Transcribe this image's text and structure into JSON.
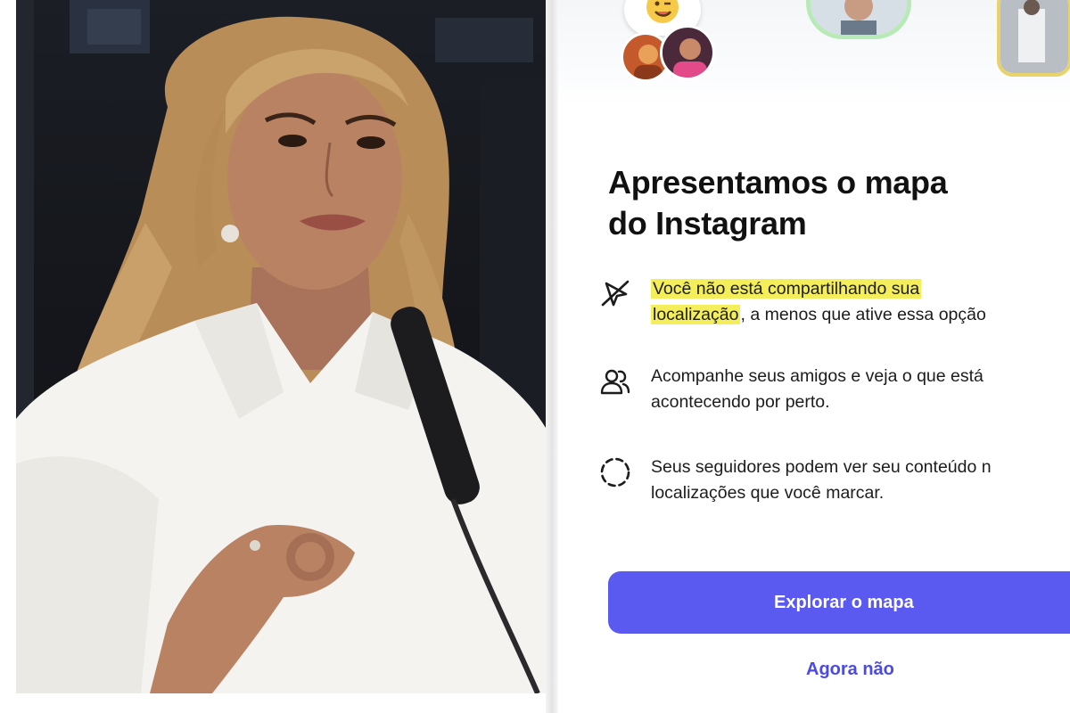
{
  "photo": {
    "subject": "Woman with blonde wavy hair in a white shirt speaking at a microphone",
    "colors": {
      "background": "#15171c",
      "shirt": "#f4f3f0",
      "hair": "#c9a06a",
      "skin": "#b98363"
    }
  },
  "instagram_map_prompt": {
    "title_line1": "Apresentamos o mapa",
    "title_line2": "do Instagram",
    "features": [
      {
        "icon": "location-off-icon",
        "line1_highlight": "Você não está compartilhando sua",
        "line2_highlight": "localização",
        "line2_rest": ", a menos que ative essa opção"
      },
      {
        "icon": "friends-icon",
        "line1": "Acompanhe seus amigos e veja o que está",
        "line2": "acontecendo por perto."
      },
      {
        "icon": "dashed-circle-icon",
        "line1": "Seus seguidores podem ver seu conteúdo n",
        "line2": "localizações que você marcar."
      }
    ],
    "primary_button": "Explorar o mapa",
    "secondary_link": "Agora não",
    "colors": {
      "accent": "#5a5af0",
      "link": "#4a4ae8",
      "highlight": "#f4ee5a"
    }
  }
}
